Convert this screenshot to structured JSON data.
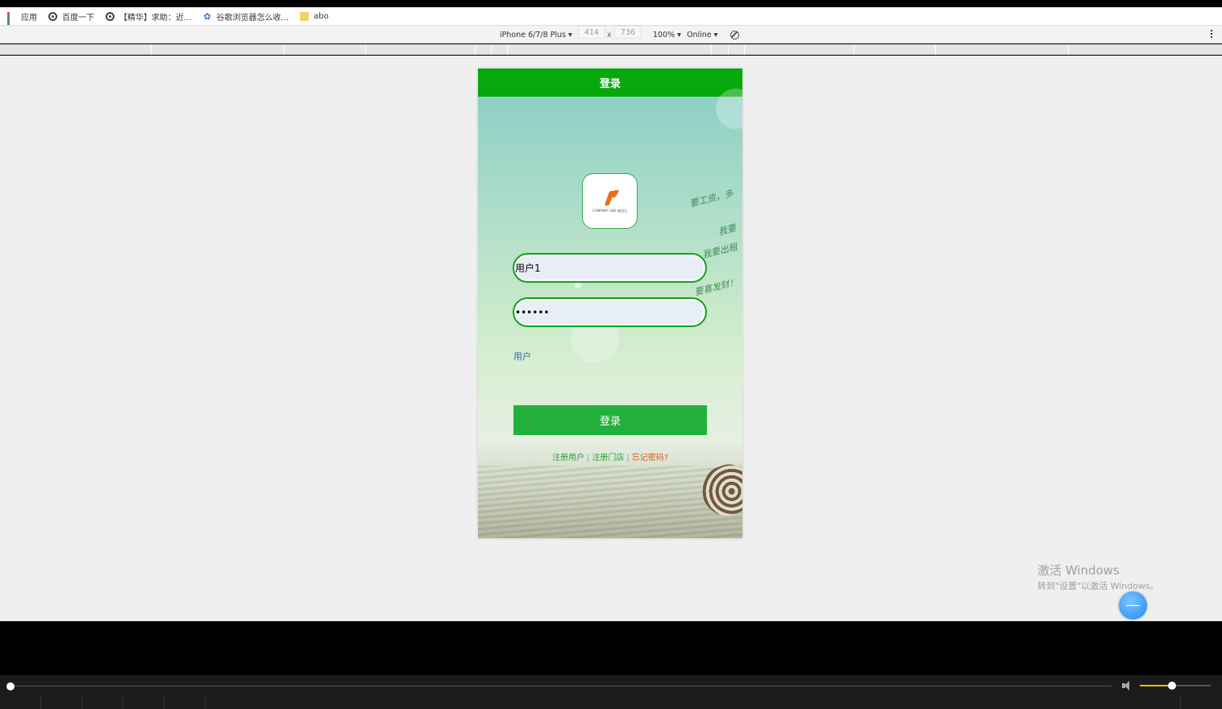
{
  "bookmarks": [
    {
      "label": "应用",
      "icon": "apps-icon"
    },
    {
      "label": "百度一下",
      "icon": "globe-icon"
    },
    {
      "label": "【精华】求助：近...",
      "icon": "globe-icon"
    },
    {
      "label": "谷歌浏览器怎么收...",
      "icon": "paw-icon"
    },
    {
      "label": "abo",
      "icon": "folder-icon"
    }
  ],
  "device_toolbar": {
    "device": "iPhone 6/7/8 Plus ▾",
    "width": "414",
    "times": "x",
    "height": "736",
    "zoom": "100% ▾",
    "network": "Online ▾"
  },
  "phone": {
    "header_title": "登录",
    "username_value": "用户1",
    "password_value": "••••••",
    "role_label": "用户",
    "login_button": "登录",
    "link_register_user": "注册用户",
    "link_register_store": "注册门店",
    "link_forgot_password": "忘记密码?",
    "separator": "|",
    "logo_text": "COMPANY LINE 新纪元"
  },
  "watermark": {
    "line1": "激活 Windows",
    "line2": "转到\"设置\"以激活 Windows。"
  },
  "player": {
    "volume_fraction": 0.45
  },
  "colors": {
    "header_green": "#07a80c",
    "button_green": "#23b13b",
    "forgot_orange": "#e05a1b"
  }
}
